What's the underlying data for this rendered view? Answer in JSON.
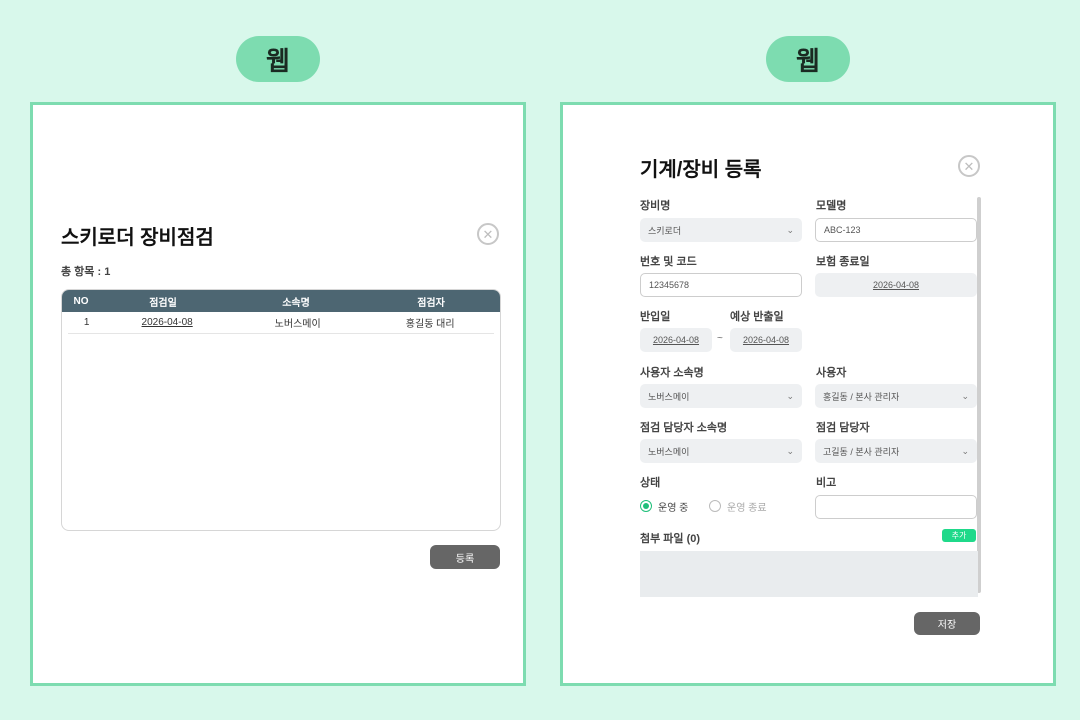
{
  "labels": {
    "left_tag": "웹",
    "right_tag": "웹"
  },
  "left_panel": {
    "title": "스키로더 장비점검",
    "total_count": "총 항목 : 1",
    "close_icon": "close-circle-icon",
    "table": {
      "headers": [
        "NO",
        "점검일",
        "소속명",
        "점검자"
      ],
      "rows": [
        {
          "no": "1",
          "date": "2026-04-08",
          "dept": "노버스메이",
          "inspector": "홍길동 대리"
        }
      ]
    },
    "register_label": "등록"
  },
  "right_panel": {
    "title": "기계/장비 등록",
    "close_icon": "close-circle-icon",
    "equipment_name": {
      "label": "장비명",
      "value": "스키로더"
    },
    "model_name": {
      "label": "모델명",
      "value": "ABC-123"
    },
    "number_code": {
      "label": "번호 및 코드",
      "value": "12345678"
    },
    "insurance_end": {
      "label": "보험 종료일",
      "value": "2026-04-08"
    },
    "import_date": {
      "label": "반입일",
      "value": "2026-04-08"
    },
    "expected_export": {
      "label": "예상 반출일",
      "value": "2026-04-08"
    },
    "range_separator": "~",
    "user_dept": {
      "label": "사용자 소속명",
      "value": "노버스메이"
    },
    "user": {
      "label": "사용자",
      "value": "홍길동 / 본사 관리자"
    },
    "inspector_dept": {
      "label": "점검 담당자 소속명",
      "value": "노버스메이"
    },
    "inspector": {
      "label": "점검 담당자",
      "value": "고길동 / 본사 관리자"
    },
    "status": {
      "label": "상태",
      "options": [
        "운영 중",
        "운영 종료"
      ],
      "selected": "운영 중"
    },
    "note": {
      "label": "비고",
      "value": ""
    },
    "attachments": {
      "label": "첨부 파일 (0)",
      "add_label": "추가"
    },
    "save_label": "저장"
  },
  "colors": {
    "background": "#d8f8eb",
    "frame_border": "#7ddcb0",
    "table_header": "#4d6672",
    "accent": "#1fd98a"
  }
}
